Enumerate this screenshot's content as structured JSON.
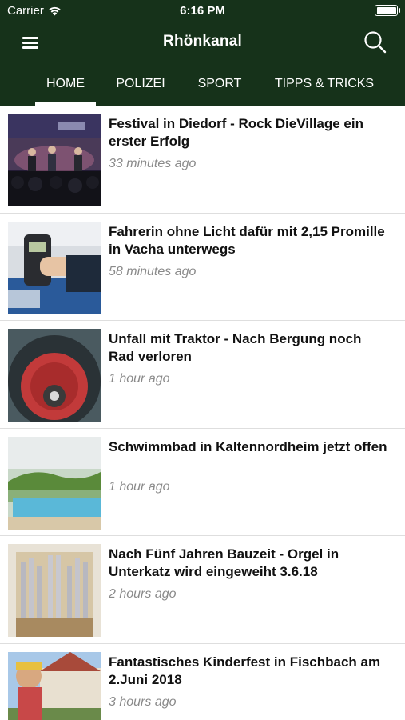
{
  "status_bar": {
    "carrier": "Carrier",
    "time": "6:16 PM",
    "battery_level": 1.0
  },
  "nav": {
    "title": "Rhönkanal",
    "menu_icon": "hamburger-menu-icon",
    "search_icon": "search-icon"
  },
  "tabs": [
    {
      "label": "HOME",
      "active": true
    },
    {
      "label": "POLIZEI",
      "active": false
    },
    {
      "label": "SPORT",
      "active": false
    },
    {
      "label": "TIPPS & TRICKS",
      "active": false
    }
  ],
  "articles": [
    {
      "title": "Festival in Diedorf - Rock DieVillage ein erster Erfolg",
      "time": "33 minutes ago",
      "thumb": "concert-stage-image"
    },
    {
      "title": "Fahrerin ohne Licht dafür mit 2,15 Promille in Vacha unterwegs",
      "time": "58 minutes ago",
      "thumb": "breathalyzer-police-image"
    },
    {
      "title": "Unfall mit Traktor - Nach Bergung noch Rad verloren",
      "time": "1 hour ago",
      "thumb": "tractor-wheel-image"
    },
    {
      "title": "Schwimmbad in Kaltennordheim jetzt offen",
      "time": "1 hour ago",
      "thumb": "swimming-pool-image"
    },
    {
      "title": "Nach Fünf Jahren Bauzeit - Orgel in Unterkatz wird eingeweiht 3.6.18",
      "time": "2 hours ago",
      "thumb": "church-organ-image"
    },
    {
      "title": "Fantastisches Kinderfest in Fischbach am 2.Juni 2018",
      "time": "3 hours ago",
      "thumb": "children-festival-image"
    }
  ],
  "colors": {
    "header_bg": "#16321a",
    "header_text": "#ffffff",
    "title_text": "#111111",
    "time_text": "#8a8a8a",
    "divider": "#dedede"
  }
}
